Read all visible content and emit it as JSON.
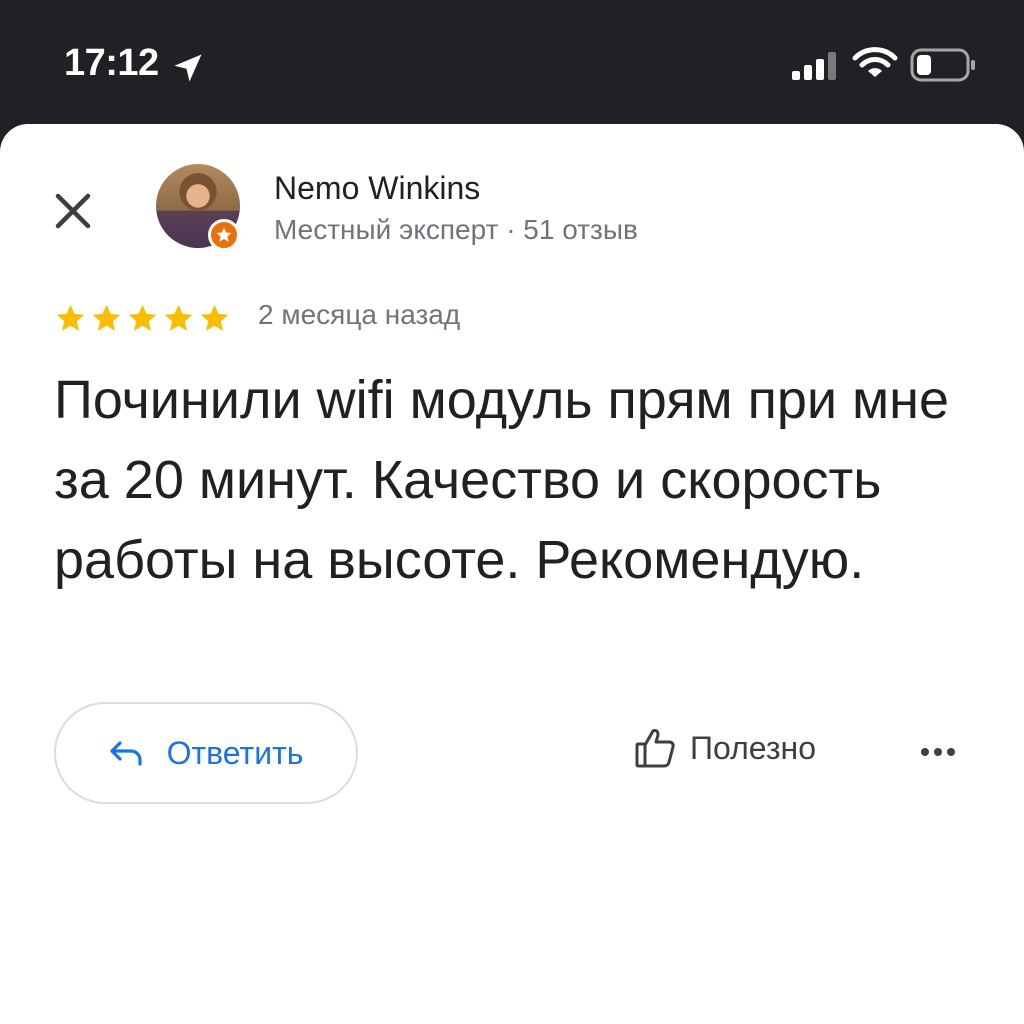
{
  "status_bar": {
    "time": "17:12",
    "icons": [
      "location-arrow-icon",
      "cellular-signal-icon",
      "wifi-icon",
      "battery-icon"
    ]
  },
  "review": {
    "close_icon": "close-icon",
    "reviewer": {
      "name": "Nemo Winkins",
      "meta": "Местный эксперт · 51 отзыв",
      "badge_icon": "local-guide-star-icon"
    },
    "rating": 5,
    "rating_max": 5,
    "date": "2 месяца назад",
    "text": "Починили wifi модуль прям при мне за 20 минут. Качество и скорость работы на высоте. Рекомендую.",
    "actions": {
      "reply_label": "Ответить",
      "reply_icon": "reply-arrow-icon",
      "helpful_label": "Полезно",
      "helpful_icon": "thumb-up-icon",
      "more_icon": "more-horizontal-icon"
    }
  },
  "colors": {
    "status_bar_bg": "#202124",
    "star": "#fbbc04",
    "accent_blue": "#1a73e8",
    "badge_orange": "#e8710a",
    "secondary_text": "#70757a"
  }
}
